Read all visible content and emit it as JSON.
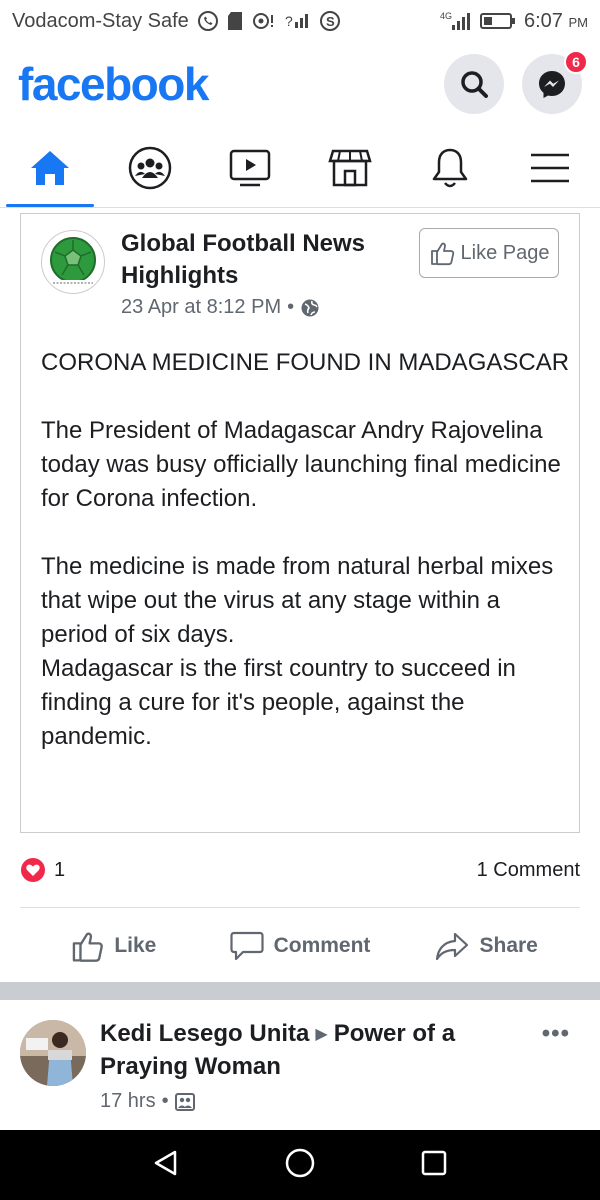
{
  "status_bar": {
    "carrier": "Vodacom-Stay Safe",
    "time": "6:07",
    "ampm": "PM",
    "network": "4G"
  },
  "header": {
    "logo": "facebook",
    "messenger_badge": "6"
  },
  "nav": {
    "tabs": [
      "home",
      "groups",
      "watch",
      "marketplace",
      "notifications",
      "menu"
    ]
  },
  "post": {
    "page_name": "Global Football News Highlights",
    "timestamp": "23 Apr at 8:12 PM",
    "like_page_label": "Like Page",
    "paragraphs": [
      "CORONA MEDICINE FOUND IN MADAGASCAR",
      "The President of Madagascar Andry Rajovelina today was busy officially launching final medicine for Corona infection.",
      "The medicine is made from natural herbal mixes that wipe out the virus at any stage within a period of six days.",
      "Madagascar is the first country to succeed in finding a cure for it's people, against the pandemic."
    ],
    "reaction_count": "1",
    "comment_count": "1 Comment",
    "actions": {
      "like": "Like",
      "comment": "Comment",
      "share": "Share"
    }
  },
  "post2": {
    "author": "Kedi Lesego Unita",
    "group": "Power of a Praying Woman",
    "time": "17 hrs",
    "more": "•••"
  },
  "colors": {
    "brand": "#1877f2",
    "reaction_red": "#f02849",
    "text_secondary": "#606770"
  }
}
